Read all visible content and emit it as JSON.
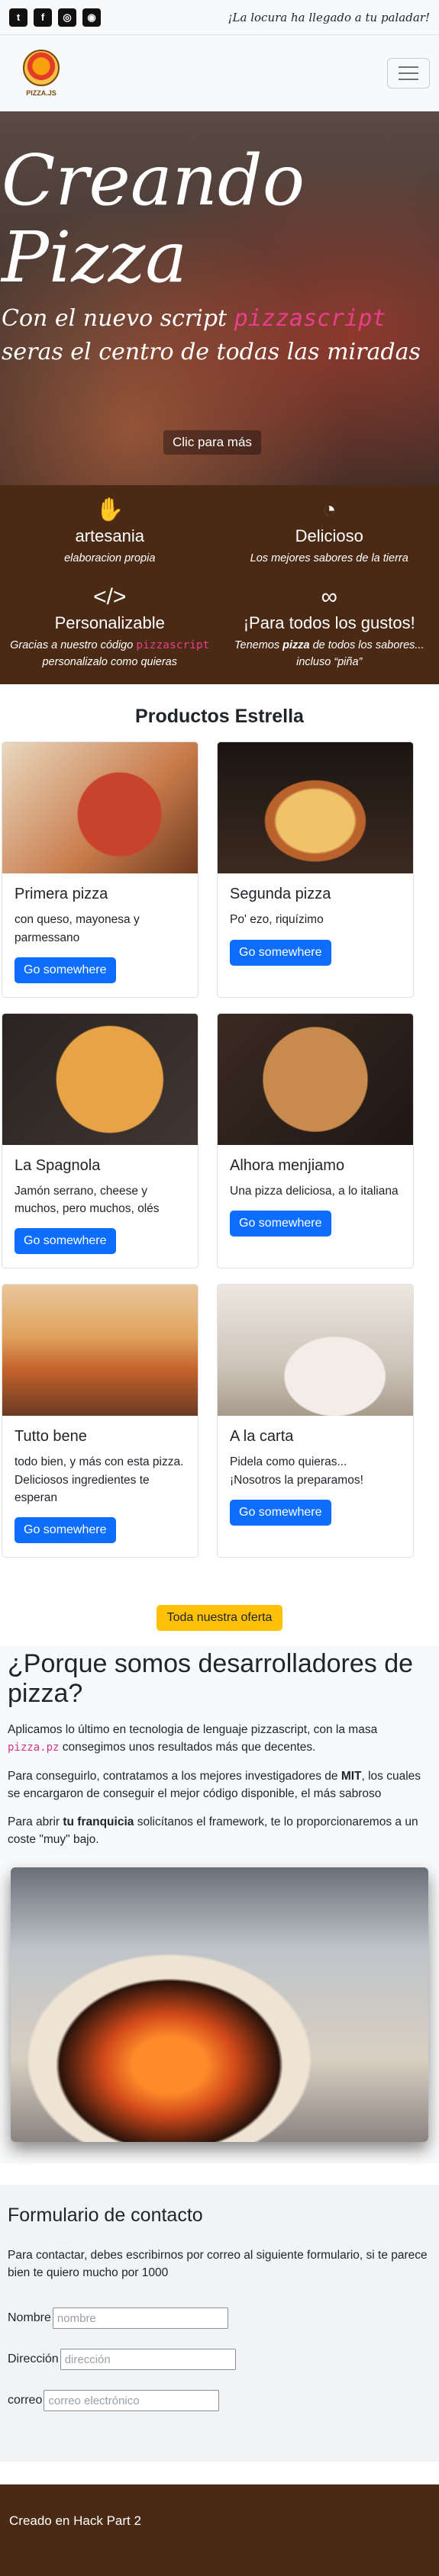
{
  "topbar": {
    "socials": [
      {
        "icon": "twitter-icon",
        "glyph": "t"
      },
      {
        "icon": "facebook-icon",
        "glyph": "f"
      },
      {
        "icon": "instagram-icon",
        "glyph": "◎"
      },
      {
        "icon": "github-icon",
        "glyph": "◉"
      }
    ],
    "tagline": "¡La locura ha llegado a tu paladar!"
  },
  "navbar": {
    "logo_text": "PIZZA.JS",
    "toggler_icon": "hamburger-menu-icon"
  },
  "hero": {
    "title_line1": "Creando",
    "title_line2": "Pizza",
    "sub_before": "Con el nuevo script ",
    "sub_code": "pizzascript",
    "sub_after": " seras el centro de todas las miradas",
    "button": "Clic para más"
  },
  "features": [
    {
      "icon": "hand-icon",
      "glyph": "✋",
      "title": "artesania",
      "desc": "elaboracion propia"
    },
    {
      "icon": "pizza-slice-icon",
      "glyph": "◔",
      "title": "Delicioso",
      "desc": "Los mejores sabores de la tierra"
    },
    {
      "icon": "code-icon",
      "glyph": "</>",
      "title": "Personalizable",
      "desc_before": "Gracias a nuestro código ",
      "desc_code": "pizzascript",
      "desc_after": " personalizalo como quieras"
    },
    {
      "icon": "infinity-icon",
      "glyph": "∞",
      "title": "¡Para todos los gustos!",
      "desc_before": "Tenemos ",
      "desc_bold": "pizza",
      "desc_after": " de todos los sabores... incluso “piña”"
    }
  ],
  "products": {
    "title": "Productos Estrella",
    "items": [
      {
        "title": "Primera pizza",
        "text": "con queso, mayonesa y parmessano",
        "button": "Go somewhere"
      },
      {
        "title": "Segunda pizza",
        "text": "Po' ezo, riquízimo",
        "button": "Go somewhere"
      },
      {
        "title": "La Spagnola",
        "text": "Jamón serrano, cheese y muchos, pero muchos, olés",
        "button": "Go somewhere"
      },
      {
        "title": "Alhora menjiamo",
        "text": "Una pizza deliciosa, a lo italiana",
        "button": "Go somewhere"
      },
      {
        "title": "Tutto bene",
        "text": "todo bien, y más con esta pizza. Deliciosos ingredientes te esperan",
        "button": "Go somewhere"
      },
      {
        "title": "A la carta",
        "text": "Pidela como quieras... ¡Nosotros la preparamos!",
        "button": "Go somewhere"
      }
    ],
    "offer_button": "Toda nuestra oferta"
  },
  "why": {
    "title": "¿Porque somos desarrolladores de pizza?",
    "p1_before": "Aplicamos lo último en tecnologia de lenguaje pizzascript, con la masa ",
    "p1_code": "pizza.pz",
    "p1_after": " consegimos unos resultados más que decentes.",
    "p2_before": "Para conseguirlo, contratamos a los mejores investigadores de ",
    "p2_bold": "MIT",
    "p2_after": ", los cuales se encargaron de conseguir el mejor código disponible, el más sabroso",
    "p3_before": "Para abrir ",
    "p3_bold": "tu franquicia",
    "p3_after": " solicítanos el framework, te lo proporcionaremos a un coste \"muy\" bajo."
  },
  "contact": {
    "title": "Formulario de contacto",
    "text": "Para contactar, debes escribirnos por correo al siguiente formulario, si te parece bien te quiero mucho por 1000",
    "fields": [
      {
        "label": "Nombre",
        "placeholder": "nombre"
      },
      {
        "label": "Dirección",
        "placeholder": "dirección"
      },
      {
        "label": "correo",
        "placeholder": "correo electrónico"
      }
    ]
  },
  "footer": {
    "text": "Creado en Hack Part 2"
  }
}
